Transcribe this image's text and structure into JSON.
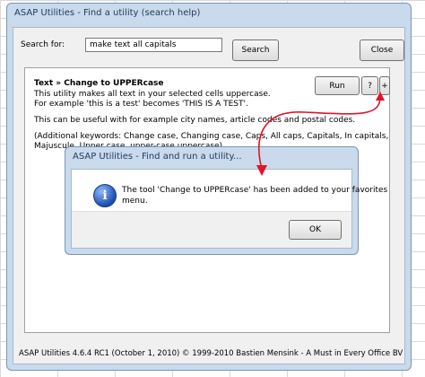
{
  "main": {
    "title": "ASAP Utilities - Find a utility (search help)",
    "search_label": "Search for:",
    "search_value": "make text all capitals",
    "search_button": "Search",
    "close_button": "Close"
  },
  "result": {
    "heading": "Text » Change to UPPERcase",
    "lines": [
      "This utility makes all text in your selected cells uppercase.",
      "For example 'this is a test' becomes 'THIS IS A TEST'."
    ],
    "useful": "This can be useful with for example city names, article codes and postal codes.",
    "keywords": [
      "(Additional keywords: Change case, Changing case, Caps, All caps, Capitals, In capitals,",
      "Majuscule, Upper case, upper-case uppercase)"
    ],
    "run_button": "Run",
    "help_button": "?",
    "add_button": "+"
  },
  "status_text": "ASAP Utilities 4.6.4 RC1 (October 1, 2010)  © 1999-2010 Bastien Mensink - A Must in Every Office BV",
  "dialog": {
    "title": "ASAP Utilities - Find and run a utility...",
    "message_line1": "The tool 'Change to UPPERcase' has been added to your favorites",
    "message_line2": "menu.",
    "ok_button": "OK",
    "icon": "info-icon"
  },
  "colors": {
    "window_frame": "#c9daed",
    "arrow": "#e0142b"
  }
}
